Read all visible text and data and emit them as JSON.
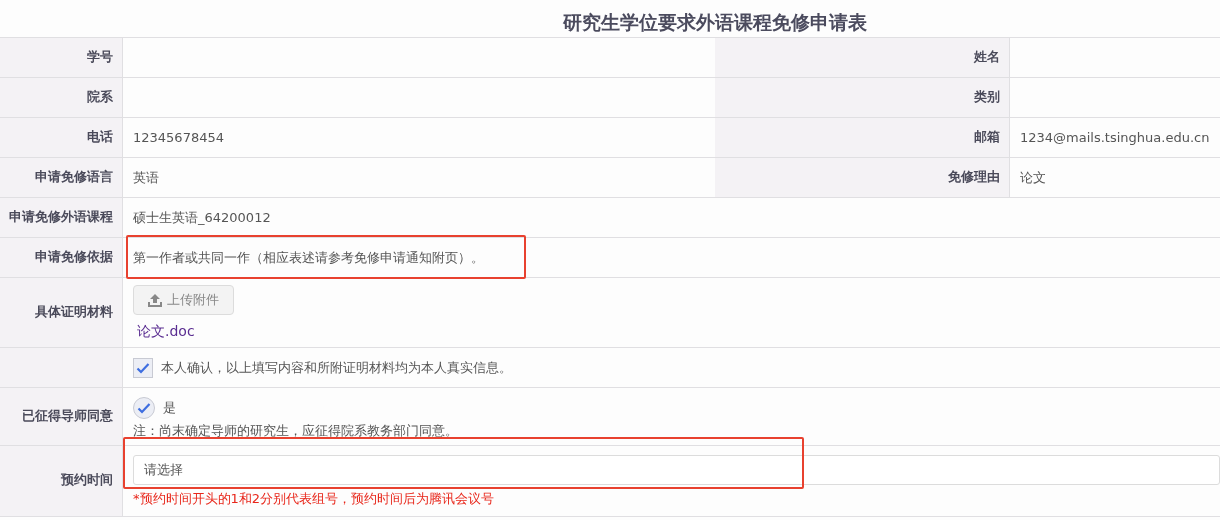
{
  "title": "研究生学位要求外语课程免修申请表",
  "rows": [
    {
      "kind": "pair",
      "fields": [
        {
          "label": "学号"
        },
        {
          "label": "姓名"
        }
      ]
    },
    {
      "kind": "pair",
      "fields": [
        {
          "label": "院系"
        },
        {
          "label": "类别"
        }
      ]
    },
    {
      "kind": "pair",
      "fields": [
        {
          "label": "电话",
          "value": "12345678454"
        },
        {
          "label": "邮箱",
          "value": "1234@mails.tsinghua.edu.cn"
        }
      ]
    },
    {
      "kind": "pair",
      "fields": [
        {
          "label": "申请免修语言",
          "value": "英语"
        },
        {
          "label": "免修理由",
          "value": "论文"
        }
      ]
    },
    {
      "kind": "text",
      "label": "申请免修外语课程",
      "value": "硕士生英语_64200012",
      "highlighted": false
    },
    {
      "kind": "text",
      "label": "申请免修依据",
      "value": "第一作者或共同一作（相应表述请参考免修申请通知附页）。",
      "highlighted": true
    },
    {
      "kind": "upload",
      "label": "具体证明材料",
      "button": "上传附件",
      "file": "论文.doc"
    },
    {
      "kind": "checkbox",
      "text": "本人确认，以上填写内容和所附证明材料均为本人真实信息。",
      "checked": true
    },
    {
      "kind": "radio",
      "label": "已征得导师同意",
      "option": "是",
      "selected": true,
      "note": "注：尚末确定导师的研究生，应征得院系教务部门同意。"
    },
    {
      "kind": "select",
      "label": "预约时间",
      "placeholder": "请选择",
      "hint": "*预约时间开头的1和2分别代表组号，预约时间后为腾讯会议号",
      "highlighted": true
    }
  ]
}
